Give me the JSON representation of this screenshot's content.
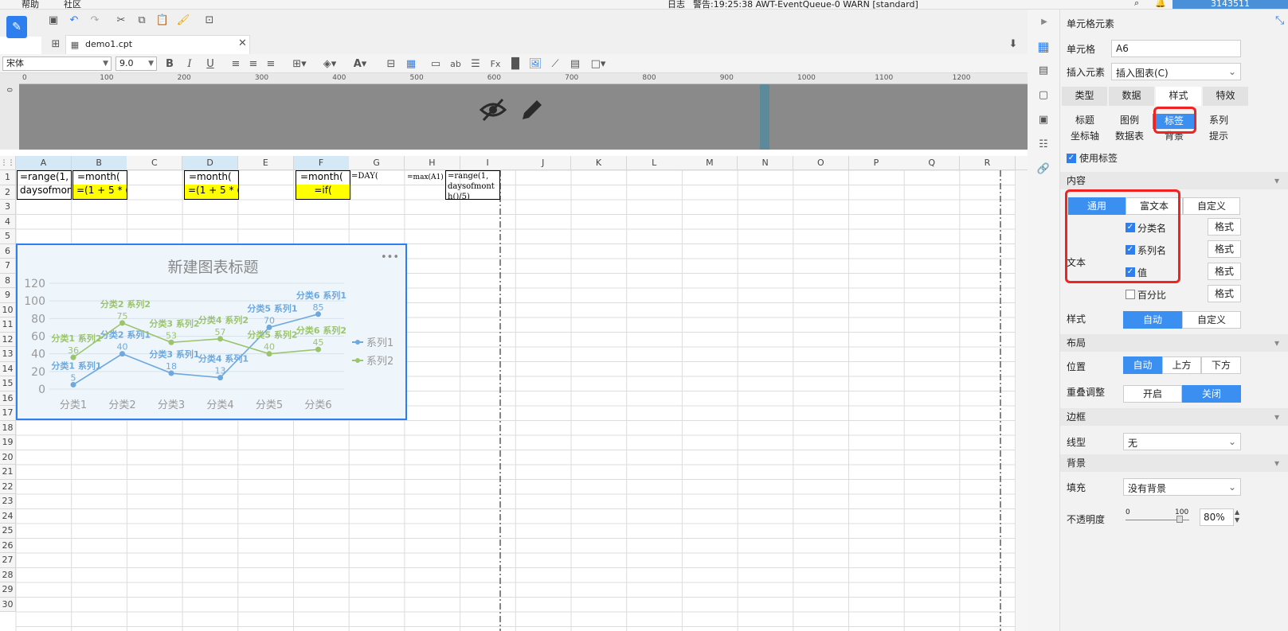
{
  "menubar": {
    "help": "帮助",
    "community": "社区",
    "log": "日志",
    "warning_text": "警告:19:25:38 AWT-EventQueue-0 WARN [standard]",
    "user_id": "3143511"
  },
  "file_tab": {
    "name": "demo1.cpt"
  },
  "font": {
    "family": "宋体",
    "size": "9.0"
  },
  "ruler": {
    "marks": [
      "0",
      "100",
      "200",
      "300",
      "400",
      "500",
      "600",
      "700",
      "800",
      "900",
      "1000",
      "1100",
      "1200"
    ]
  },
  "columns": [
    "A",
    "B",
    "C",
    "D",
    "E",
    "F",
    "G",
    "H",
    "I",
    "J",
    "K",
    "L",
    "M",
    "N",
    "O",
    "P",
    "Q",
    "R"
  ],
  "rows": [
    "1",
    "2",
    "3",
    "4",
    "5",
    "6",
    "7",
    "8",
    "9",
    "10",
    "11",
    "12",
    "13",
    "14",
    "15",
    "16",
    "17",
    "18",
    "19",
    "20",
    "21",
    "22",
    "23",
    "24",
    "25",
    "26",
    "27",
    "28",
    "29",
    "30"
  ],
  "cells": {
    "a1": "=range(1,",
    "a2": "daysofmon",
    "b1": "=month(",
    "b2": "=(1 + 5 * (",
    "d1": "=month(",
    "d2": "=(1 + 5 * (",
    "f1": "=month(",
    "f2": "=if(",
    "g1": "=DAY(",
    "h1": "=max(A1)",
    "i1": "=range(1,",
    "i2": "daysofmont",
    "i3": "h()/5)"
  },
  "chart": {
    "title": "新建图表标题",
    "more": "•••"
  },
  "chart_data": {
    "type": "line",
    "categories": [
      "分类1",
      "分类2",
      "分类3",
      "分类4",
      "分类5",
      "分类6"
    ],
    "series": [
      {
        "name": "系列1",
        "values": [
          5,
          40,
          18,
          13,
          70,
          85
        ],
        "color": "#6fa8dc"
      },
      {
        "name": "系列2",
        "values": [
          36,
          75,
          53,
          57,
          40,
          45
        ],
        "color": "#9bc46d"
      }
    ],
    "ylim": [
      0,
      120
    ],
    "yticks": [
      "0",
      "20",
      "40",
      "60",
      "80",
      "100",
      "120"
    ],
    "title": "新建图表标题",
    "legend": "right"
  },
  "panel": {
    "title": "单元格元素",
    "cell_label": "单元格",
    "cell_value": "A6",
    "insert_label": "插入元素",
    "insert_value": "插入图表(C)",
    "tabs": [
      "类型",
      "数据",
      "样式",
      "特效"
    ],
    "subtabs_row1": [
      "标题",
      "图例",
      "标签",
      "系列"
    ],
    "subtabs_row2": [
      "坐标轴",
      "数据表",
      "背景",
      "提示"
    ],
    "use_label": "使用标签",
    "content_header": "内容",
    "content_tabs": [
      "通用",
      "富文本",
      "自定义"
    ],
    "text_label": "文本",
    "options": [
      "分类名",
      "系列名",
      "值",
      "百分比"
    ],
    "format_btn": "格式",
    "style_label": "样式",
    "style_opts": [
      "自动",
      "自定义"
    ],
    "layout_header": "布局",
    "position_label": "位置",
    "position_opts": [
      "自动",
      "上方",
      "下方"
    ],
    "overlap_label": "重叠调整",
    "overlap_opts": [
      "开启",
      "关闭"
    ],
    "border_header": "边框",
    "linetype_label": "线型",
    "linetype_value": "无",
    "bg_header": "背景",
    "fill_label": "填充",
    "fill_value": "没有背景",
    "opacity_label": "不透明度",
    "opacity_min": "0",
    "opacity_max": "100",
    "opacity_value": "80%"
  }
}
